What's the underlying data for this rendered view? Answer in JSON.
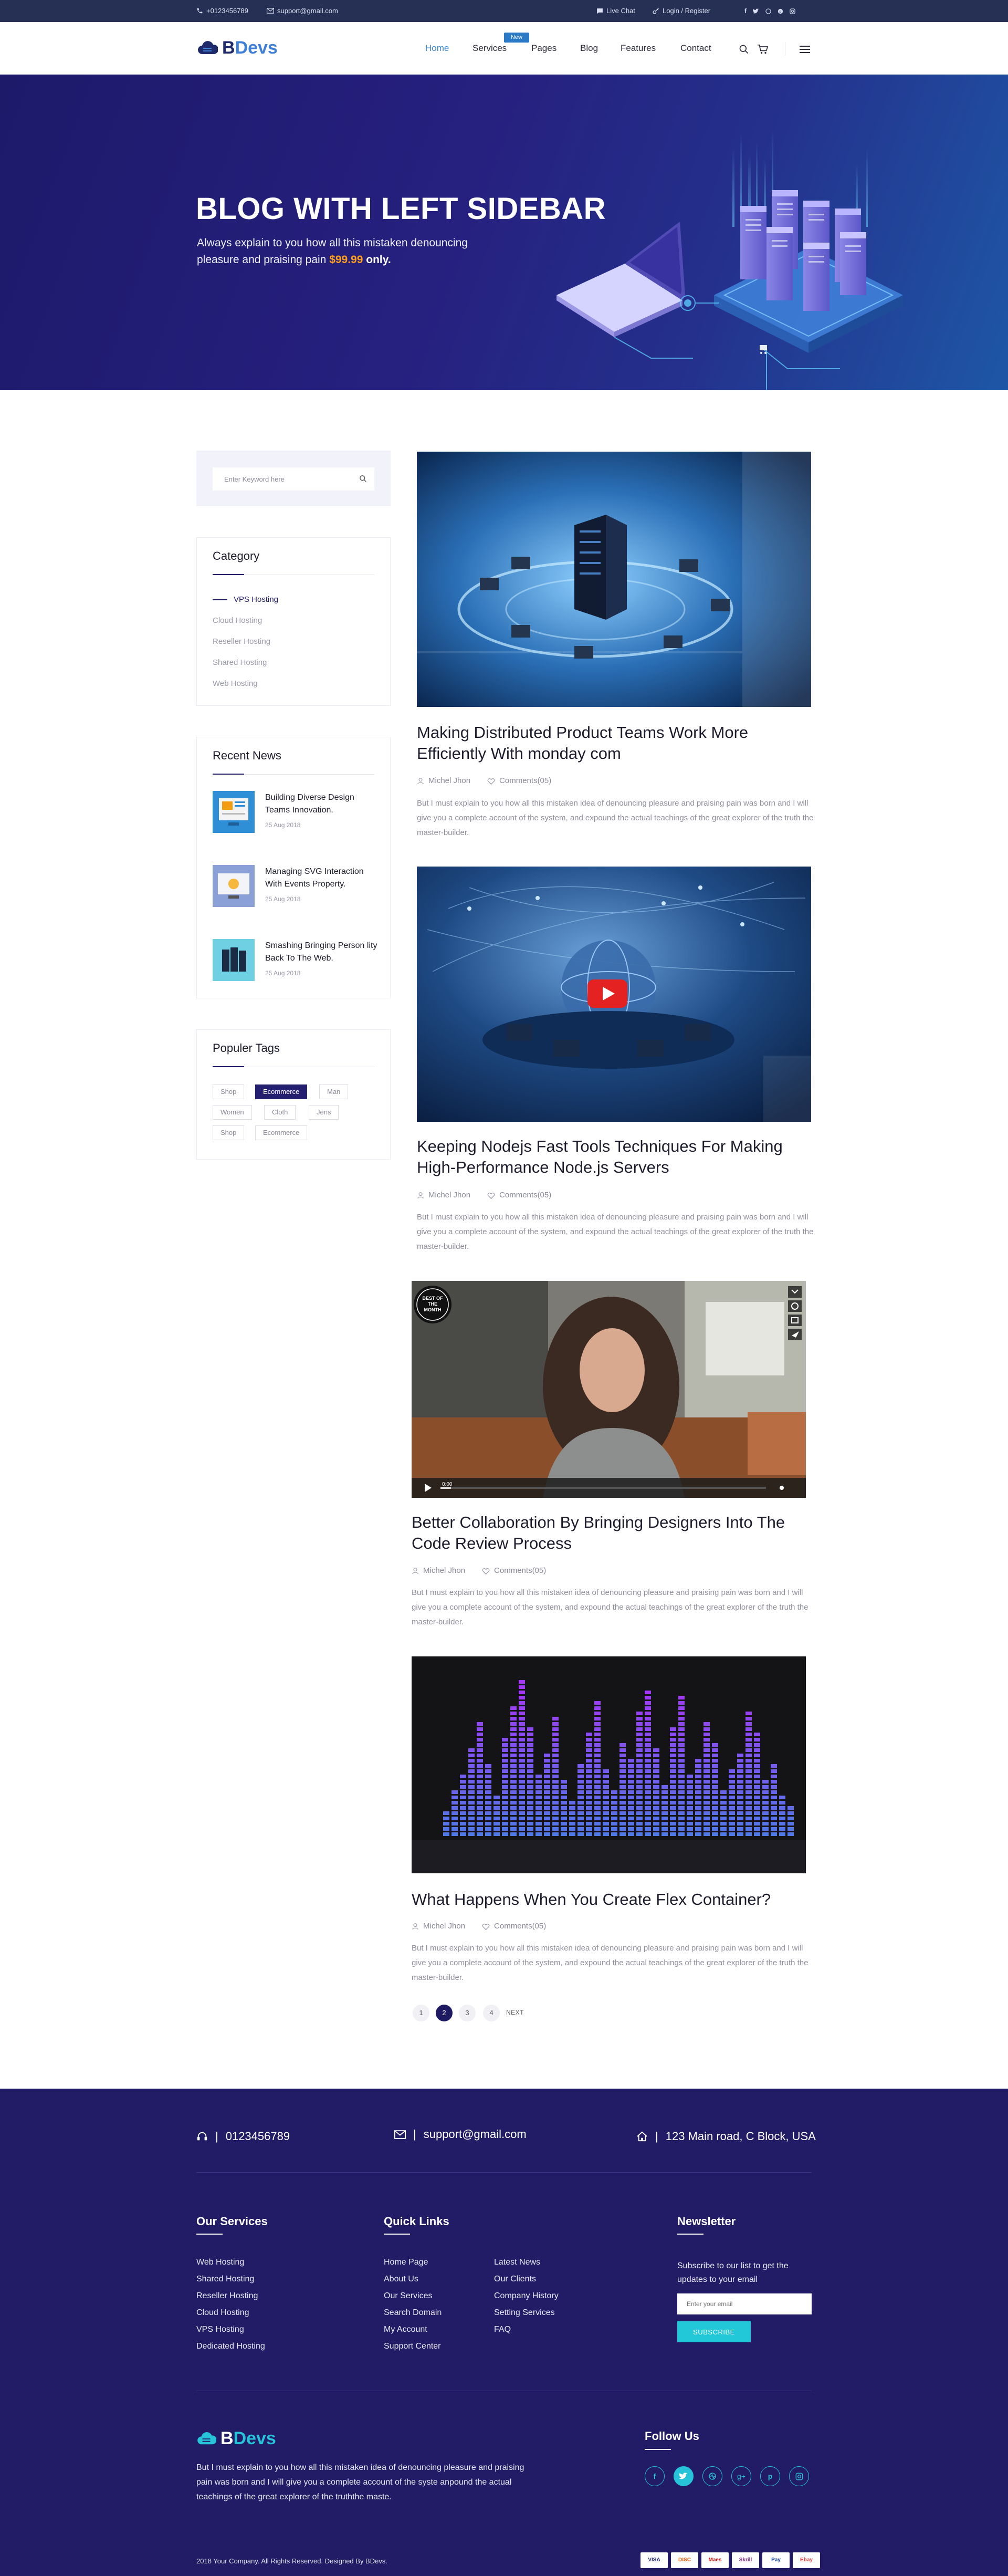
{
  "topbar": {
    "phone": "+0123456789",
    "email": "support@gmail.com",
    "live_chat": "Live Chat",
    "login": "Login / Register"
  },
  "header": {
    "logo_b": "B",
    "logo_devs": "Devs",
    "nav": [
      "Home",
      "Services",
      "Pages",
      "Blog",
      "Features",
      "Contact"
    ],
    "new_badge": "New"
  },
  "hero": {
    "title": "BLOG WITH LEFT SIDEBAR",
    "subtitle_line1": "Always explain to you how all this mistaken denouncing",
    "subtitle_line2": "pleasure and praising pain ",
    "price": "$99.99",
    "only": "only."
  },
  "sidebar": {
    "search_placeholder": "Enter Keyword here",
    "category_title": "Category",
    "categories": [
      "VPS Hosting",
      "Cloud Hosting",
      "Reseller Hosting",
      "Shared Hosting",
      "Web Hosting"
    ],
    "recent_title": "Recent News",
    "recent": [
      {
        "title": "Building Diverse Design Teams Innovation.",
        "date": "25 Aug 2018"
      },
      {
        "title": "Managing SVG Interaction With Events Property.",
        "date": "25 Aug 2018"
      },
      {
        "title": "Smashing Bringing Person lity Back To The Web.",
        "date": "25 Aug 2018"
      }
    ],
    "tags_title": "Populer Tags",
    "tags": [
      "Shop",
      "Ecommerce",
      "Man",
      "Women",
      "Cloth",
      "Jens",
      "Shop",
      "Ecommerce"
    ]
  },
  "posts": [
    {
      "title": "Making Distributed Product Teams Work More Efficiently With monday com",
      "author": "Michel Jhon",
      "comments": "Comments(05)",
      "excerpt": "But I must explain to you how all this mistaken idea of denouncing pleasure and praising pain was born and I will give you a complete account of the system, and expound the actual teachings of the great explorer of the truth the master-builder."
    },
    {
      "title": "Keeping Nodejs Fast Tools Techniques For Making High-Performance Node.js Servers",
      "author": "Michel Jhon",
      "comments": "Comments(05)",
      "excerpt": "But I must explain to you how all this mistaken idea of denouncing pleasure and praising pain was born and I will give you a complete account of the system, and expound the actual teachings of the great explorer of the truth the master-builder."
    },
    {
      "title": "Better Collaboration By Bringing Designers Into The Code Review Process",
      "author": "Michel Jhon",
      "comments": "Comments(05)",
      "excerpt": "But I must explain to you how all this mistaken idea of denouncing pleasure and praising pain was born and I will give you a complete account of the system, and expound the actual teachings of the great explorer of the truth the master-builder."
    },
    {
      "title": "What Happens When You Create Flex Container?",
      "author": "Michel Jhon",
      "comments": "Comments(05)",
      "excerpt": "But I must explain to you how all this mistaken idea of denouncing pleasure and praising pain was born and I will give you a complete account of the system, and expound the actual teachings of the great explorer of the truth the master-builder."
    }
  ],
  "video_badge": "BEST OF THE MONTH",
  "video_time": "0:00",
  "pagination": {
    "pages": [
      "1",
      "2",
      "3",
      "4"
    ],
    "active_page": "2",
    "next": "NEXT"
  },
  "footer": {
    "phone": "0123456789",
    "email": "support@gmail.com",
    "address": "123 Main road, C Block, USA",
    "services_title": "Our Services",
    "services": [
      "Web Hosting",
      "Shared Hosting",
      "Reseller Hosting",
      "Cloud Hosting",
      "VPS Hosting",
      "Dedicated Hosting"
    ],
    "quick_title": "Quick Links",
    "quick_col1": [
      "Home Page",
      "About Us",
      "Our Services",
      "Search Domain",
      "My Account",
      "Support Center"
    ],
    "quick_col2": [
      "Latest News",
      "Our Clients",
      "Company History",
      "Setting Services",
      "FAQ"
    ],
    "newsletter_title": "Newsletter",
    "newsletter_text": "Subscribe to our list to get the updates to your email",
    "email_placeholder": "Enter your email",
    "subscribe": "SUBSCRIBE",
    "logo_b": "B",
    "logo_devs": "Devs",
    "description": "But I must explain to you how all this mistaken idea of denouncing pleasure and praising pain was born and I will give you a complete account of the syste anpound the actual teachings of the great explorer of the truththe maste.",
    "follow_title": "Follow Us",
    "copyright": "2018 Your Company. All Rights Reserved. Designed By BDevs.",
    "payments": [
      "VISA",
      "DISC",
      "Maes",
      "Skrill",
      "Pay",
      "Ebay"
    ]
  },
  "colors": {
    "primary": "#24206f",
    "accent": "#27c3d8",
    "link": "#3b86d4",
    "price": "#ff9f1c"
  }
}
